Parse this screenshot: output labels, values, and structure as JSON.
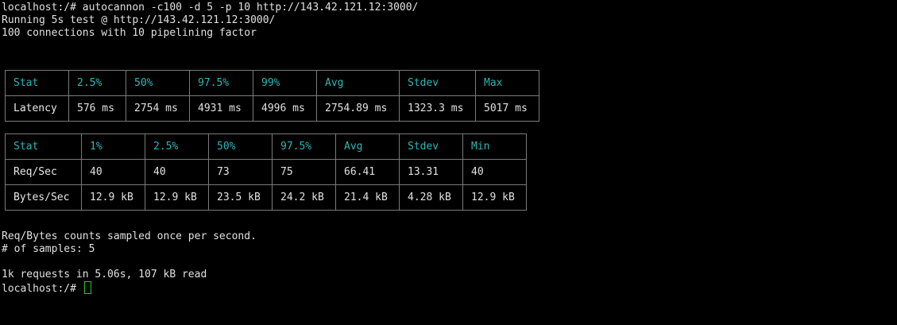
{
  "terminal": {
    "lines_top": [
      "localhost:/# autocannon -c100 -d 5 -p 10 http://143.42.121.12:3000/",
      "Running 5s test @ http://143.42.121.12:3000/",
      "100 connections with 10 pipelining factor"
    ],
    "latency_table": {
      "headers": [
        "Stat",
        "2.5%",
        "50%",
        "97.5%",
        "99%",
        "Avg",
        "Stdev",
        "Max"
      ],
      "rows": [
        [
          "Latency",
          "576 ms",
          "2754 ms",
          "4931 ms",
          "4996 ms",
          "2754.89 ms",
          "1323.3 ms",
          "5017 ms"
        ]
      ]
    },
    "throughput_table": {
      "headers": [
        "Stat",
        "1%",
        "2.5%",
        "50%",
        "97.5%",
        "Avg",
        "Stdev",
        "Min"
      ],
      "rows": [
        [
          "Req/Sec",
          "40",
          "40",
          "73",
          "75",
          "66.41",
          "13.31",
          "40"
        ],
        [
          "Bytes/Sec",
          "12.9 kB",
          "12.9 kB",
          "23.5 kB",
          "24.2 kB",
          "21.4 kB",
          "4.28 kB",
          "12.9 kB"
        ]
      ]
    },
    "lines_bottom": [
      "Req/Bytes counts sampled once per second.",
      "# of samples: 5",
      "1k requests in 5.06s, 107 kB read"
    ],
    "prompt": "localhost:/# ",
    "colors": {
      "background": "#000000",
      "text": "#e0e0e0",
      "header_text": "#2fb5b5",
      "table_border": "#7a7a7a",
      "cursor": "#1ec81e"
    }
  }
}
